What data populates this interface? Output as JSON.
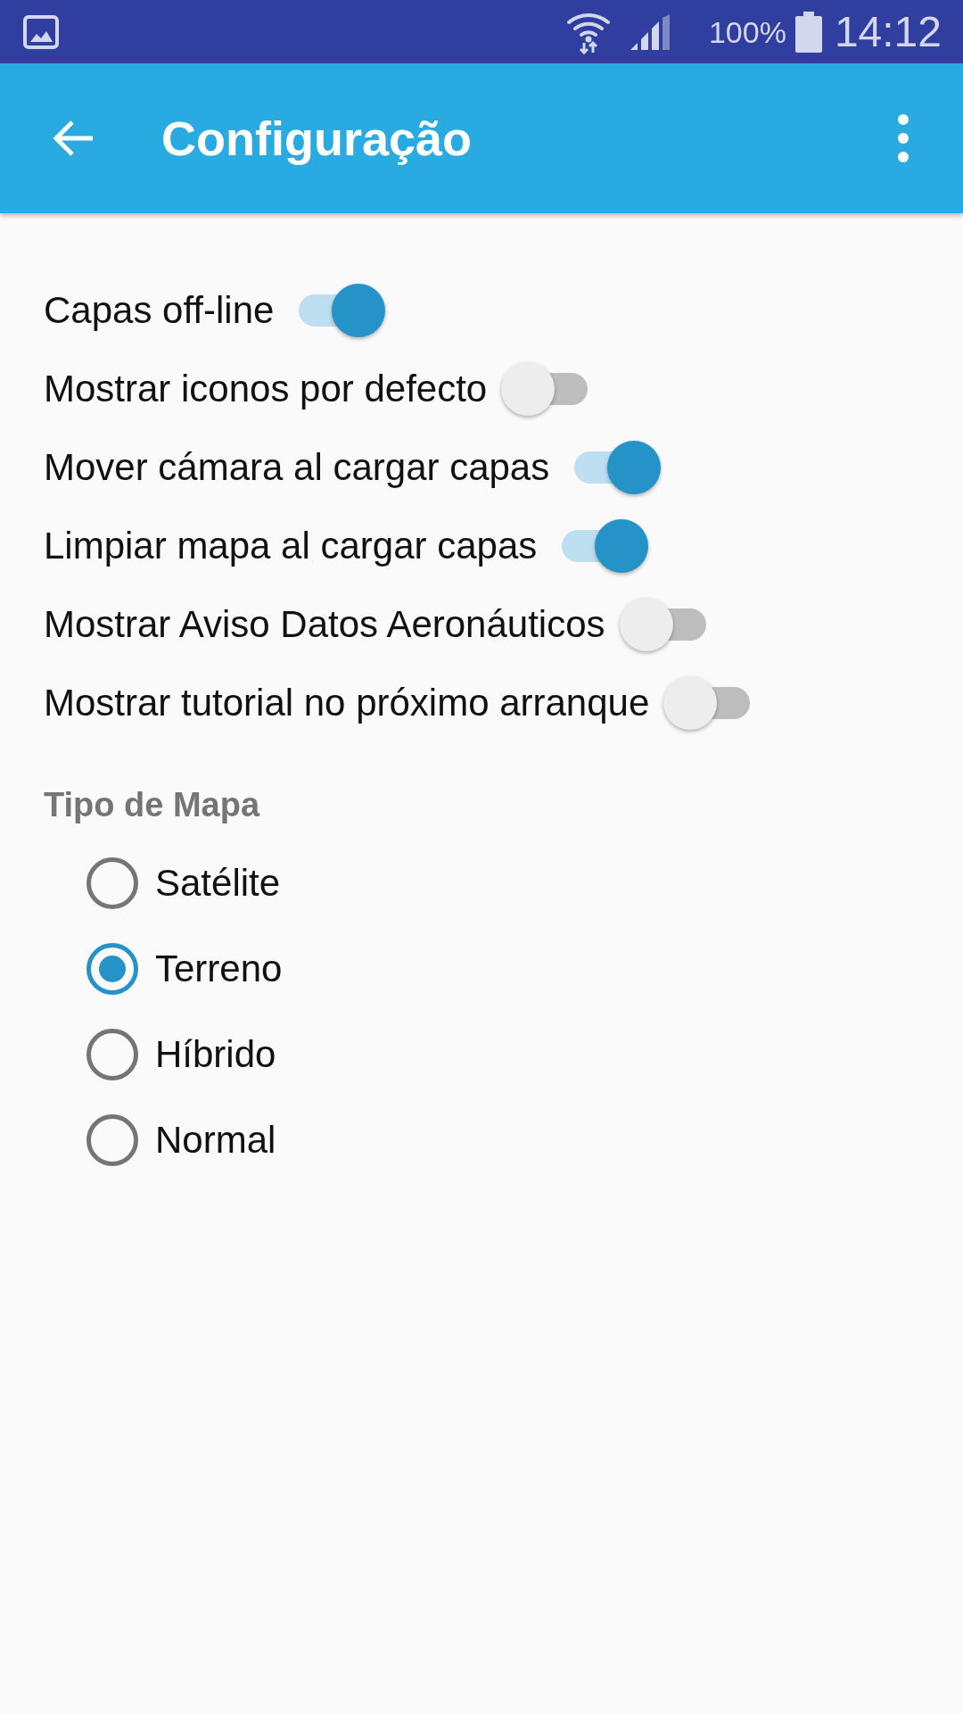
{
  "status_bar": {
    "battery_percent": "100%",
    "time": "14:12"
  },
  "app_bar": {
    "title": "Configuração"
  },
  "settings": [
    {
      "label": "Capas off-line",
      "on": true
    },
    {
      "label": "Mostrar iconos por defecto",
      "on": false
    },
    {
      "label": "Mover cámara al cargar capas",
      "on": true
    },
    {
      "label": "Limpiar mapa al cargar capas",
      "on": true
    },
    {
      "label": "Mostrar Aviso Datos Aeronáuticos",
      "on": false
    },
    {
      "label": "Mostrar tutorial no próximo arranque",
      "on": false
    }
  ],
  "map_type": {
    "title": "Tipo de Mapa",
    "options": [
      {
        "label": "Satélite",
        "selected": false
      },
      {
        "label": "Terreno",
        "selected": true
      },
      {
        "label": "Híbrido",
        "selected": false
      },
      {
        "label": "Normal",
        "selected": false
      }
    ]
  }
}
